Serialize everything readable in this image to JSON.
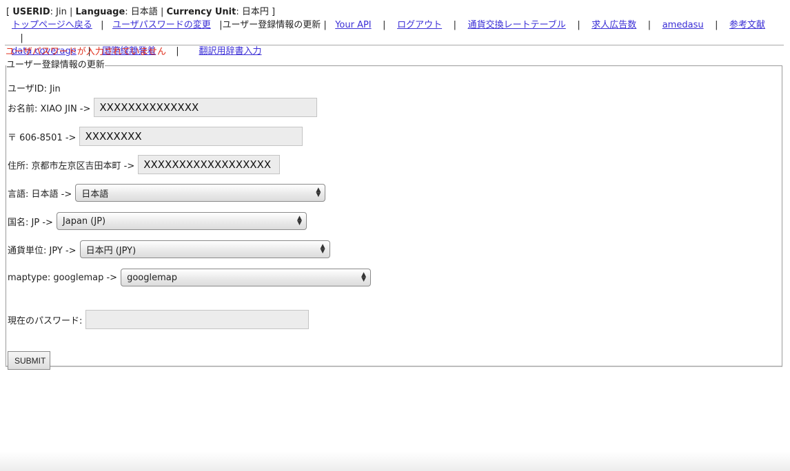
{
  "status": {
    "open": "[",
    "userid_label": "USERID",
    "userid_value": ": Jin |",
    "language_label": "Language",
    "language_value": ": 日本語 |",
    "currency_label": "Currency Unit",
    "currency_value": ": 日本円 ]"
  },
  "nav": {
    "top": "トップページへ戻る",
    "password": "ユーザパスワードの変更",
    "current": "ユーザー登録情報の更新",
    "api": "Your API",
    "logout": "ログアウト",
    "rate": "通貨交換レートテーブル",
    "jobs": "求人広告数",
    "amedasu": "amedasu",
    "refs": "参考文献",
    "coverage": "data coverage",
    "intl": "国際線離発着",
    "dict": "翻訳用辞書入力",
    "sep": "|"
  },
  "error": "ユーザパスワードが入力されていません",
  "form": {
    "legend": "ユーザー登録情報の更新",
    "userid": "ユーザID: Jin",
    "name_label": "お名前: XIAO JIN ->",
    "name_value": "XXXXXXXXXXXXXX",
    "zip_label": "〒 606-8501 ->",
    "zip_value": "XXXXXXXX",
    "address_label": "住所: 京都市左京区吉田本町 ->",
    "address_value": "XXXXXXXXXXXXXXXXXX",
    "lang_label": "言語: 日本語 ->",
    "lang_value": "日本語",
    "country_label": "国名: JP ->",
    "country_value": "Japan (JP)",
    "currency_label": "通貨単位: JPY ->",
    "currency_value": "日本円 (JPY)",
    "maptype_label": "maptype: googlemap ->",
    "maptype_value": "googlemap",
    "password_label": "現在のパスワード:",
    "password_value": "",
    "submit": "SUBMIT"
  },
  "icons": {
    "select_arrows": "up-down-chevron-icon"
  }
}
